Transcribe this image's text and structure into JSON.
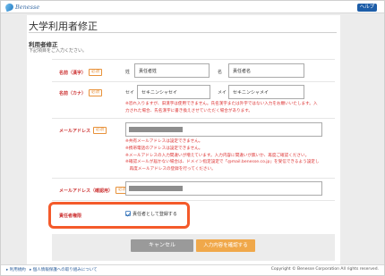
{
  "header": {
    "logo_text": "Benesse",
    "help_label": "ヘルプ"
  },
  "page": {
    "title": "大学利用者修正",
    "section_title": "利用者修正",
    "section_subtitle": "下記項目をご入力ください。"
  },
  "required_badge": "必須",
  "name_kanji": {
    "label": "名前（漢字）",
    "sei_label": "姓",
    "sei_value": "責任者姓",
    "mei_label": "名",
    "mei_value": "責任者名"
  },
  "name_kana": {
    "label": "名前（カナ）",
    "sei_label": "セイ",
    "sei_value": "セキニンシャセイ",
    "mei_label": "メイ",
    "mei_value": "セキニンシャメイ",
    "notes": [
      "※恐れ入りますが、旧漢字は使用できません。氏名漢字または外字ではない入力をお願いいたします。入",
      "力された場合、氏名漢字に書き換えさせていただく場合があります。"
    ]
  },
  "email": {
    "label": "メールアドレス",
    "notes": [
      "※共有メールアドレスは設定できません。",
      "※携帯電話のアドレスは設定できません。",
      "※メールアドレスの入力間違いが増えています。入力内容に間違いが無いか、再度ご確認ください。",
      "※確認メールが届かない場合は、ドメイン指定設定で「@mail.benesse.co.jp」を受信できるよう設定し",
      "　再度メールアドレスの登録を行ってください。"
    ]
  },
  "email_confirm": {
    "label": "メールアドレス（確認用）"
  },
  "role": {
    "label": "責任者権限",
    "checkbox_label": "責任者として登録する",
    "checked": true
  },
  "buttons": {
    "cancel": "キャンセル",
    "confirm": "入力内容を確認する"
  },
  "footer": {
    "link1": "▸ 利用規約",
    "link2": "▸ 個人情報保護への取り組みについて",
    "copyright": "Copyright © Benesse Corporation All rights reserved."
  },
  "colors": {
    "accent": "#1e5ea8",
    "required": "#e8923a",
    "error": "#d33",
    "highlight": "#f45a2a",
    "confirm_button": "#f0a84a"
  }
}
